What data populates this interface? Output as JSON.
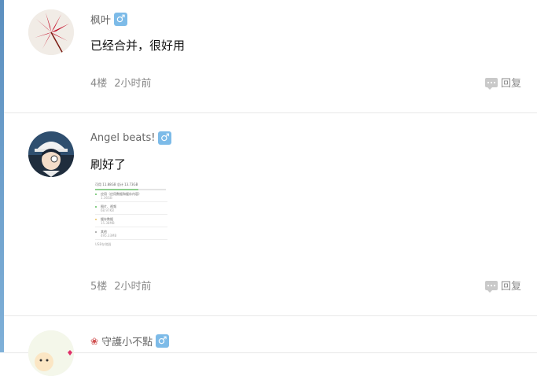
{
  "posts": [
    {
      "username": "枫叶",
      "gender": "♂",
      "content": "已经合并，很好用",
      "floor": "4楼",
      "time": "2小时前",
      "reply": "回复"
    },
    {
      "username": "Angel beats!",
      "gender": "♂",
      "content": "刷好了",
      "floor": "5楼",
      "time": "2小时前",
      "reply": "回复",
      "screenshot": {
        "header": "可用 11.88GB  总计 13.73GB",
        "rows": [
          {
            "title": "应用（应用数据和缓存内容）",
            "size": "1.36GB",
            "color": "#5fbf5f"
          },
          {
            "title": "图片、视频",
            "size": "68.97KB",
            "color": "#5fbf5f"
          },
          {
            "title": "缓存数据",
            "size": "15.38MB",
            "color": "#e8c060"
          },
          {
            "title": "其他",
            "size": "495.33MB",
            "color": "#9a9a9a"
          }
        ],
        "footer": "USB存储器"
      }
    },
    {
      "username": "守護小不點",
      "gender": "♂",
      "flower": "❀"
    }
  ]
}
